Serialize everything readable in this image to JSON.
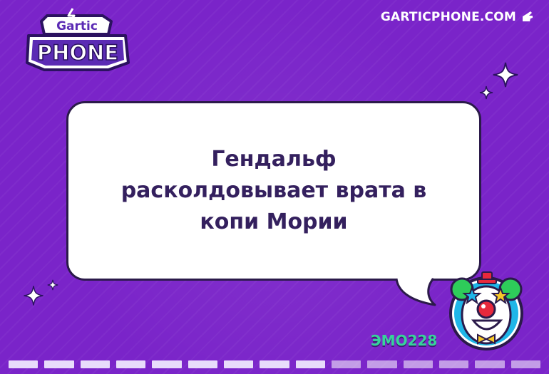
{
  "logo": {
    "line1": "Gartic",
    "line2": "PHONE"
  },
  "header": {
    "site_label": "GARTICPHONE.COM",
    "site_icon": "hand-pointer-icon"
  },
  "card": {
    "text": "Гендальф расколдовывает врата в копи Мории"
  },
  "player": {
    "name": "ЭМО228",
    "avatar": "clown-avatar"
  },
  "progress": {
    "segments": 15,
    "active": 9
  },
  "colors": {
    "background": "#7a24c9",
    "text": "#34205e",
    "username": "#36d39a",
    "bubble": "#ffffff"
  }
}
